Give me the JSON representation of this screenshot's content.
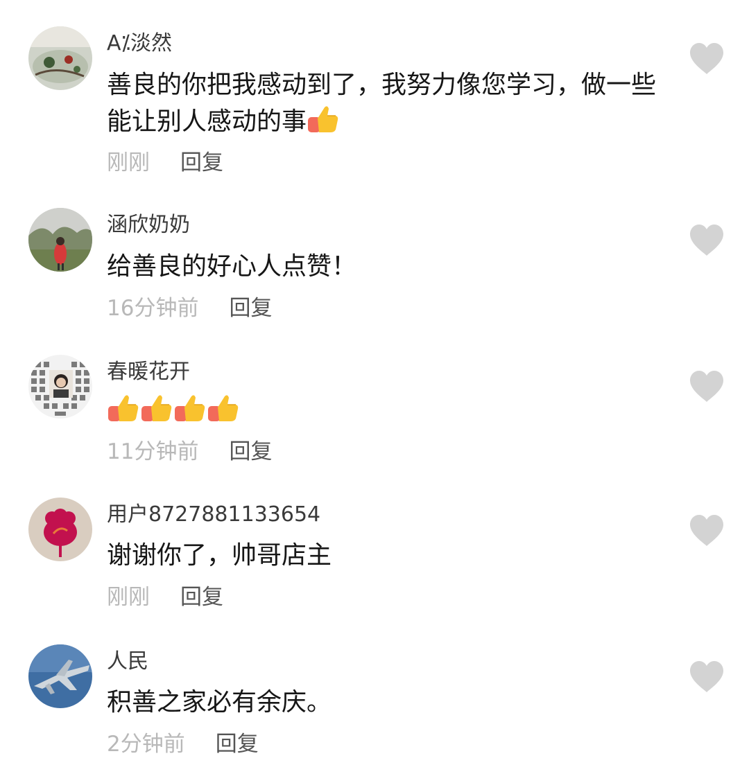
{
  "colors": {
    "username": "#3a3a3a",
    "content": "#161616",
    "time": "#b8b8b8",
    "reply": "#555555",
    "like_icon": "#d3d3d3"
  },
  "comments": [
    {
      "username": "A⁒淡然",
      "text": "善良的你把我感动到了，我努力像您学习，做一些能让别人感动的事",
      "emoji_after_text": [
        "thumbs-up"
      ],
      "time": "刚刚",
      "reply_label": "回复",
      "like_icon": "heart-icon"
    },
    {
      "username": "涵欣奶奶",
      "text": "给善良的好心人点赞！",
      "emoji_after_text": [],
      "time": "16分钟前",
      "reply_label": "回复",
      "like_icon": "heart-icon"
    },
    {
      "username": "春暖花开",
      "text": "",
      "emoji_after_text": [
        "thumbs-up",
        "thumbs-up",
        "thumbs-up",
        "thumbs-up"
      ],
      "time": "11分钟前",
      "reply_label": "回复",
      "like_icon": "heart-icon"
    },
    {
      "username": "用户8727881133654",
      "text": "谢谢你了，帅哥店主",
      "emoji_after_text": [],
      "time": "刚刚",
      "reply_label": "回复",
      "like_icon": "heart-icon"
    },
    {
      "username": "人民",
      "text": "积善之家必有余庆。",
      "emoji_after_text": [],
      "time": "2分钟前",
      "reply_label": "回复",
      "like_icon": "heart-icon"
    }
  ]
}
